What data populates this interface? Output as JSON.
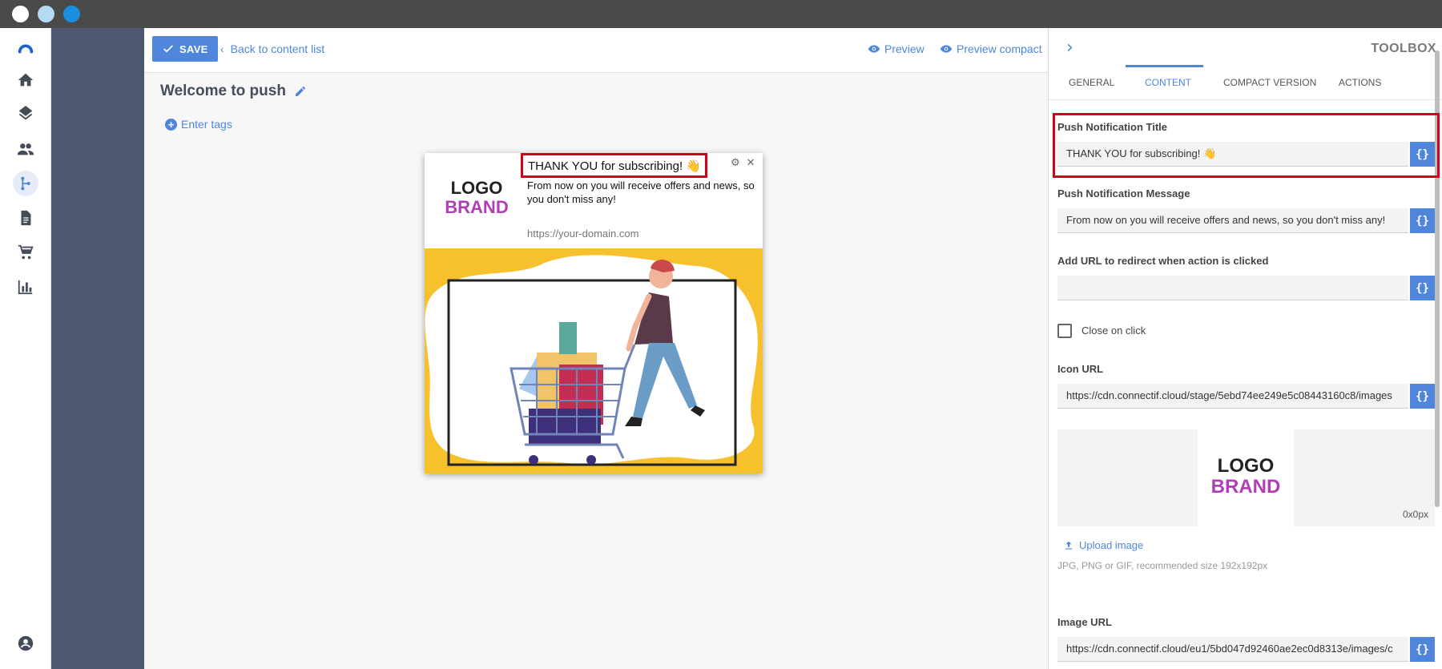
{
  "toolbar": {
    "save_label": "SAVE",
    "back_label": "Back to content list",
    "preview_label": "Preview",
    "preview_compact_label": "Preview compact"
  },
  "editor": {
    "title": "Welcome to push",
    "tags_label": "Enter tags"
  },
  "notification": {
    "logo_line1": "LOGO",
    "logo_line2": "BRAND",
    "title": "THANK YOU for subscribing! 👋",
    "message": "From now on you will receive offers and news, so you don't miss any!",
    "url": "https://your-domain.com"
  },
  "toolbox": {
    "title": "TOOLBOX",
    "tabs": [
      {
        "label": "GENERAL"
      },
      {
        "label": "CONTENT"
      },
      {
        "label": "COMPACT VERSION"
      },
      {
        "label": "ACTIONS"
      }
    ],
    "active_tab": "CONTENT",
    "push_title_label": "Push Notification Title",
    "push_title_value": "THANK YOU for subscribing! 👋",
    "push_message_label": "Push Notification Message",
    "push_message_value": "From now on you will receive offers and news, so you don't miss any!",
    "redirect_label": "Add URL to redirect when action is clicked",
    "redirect_value": "",
    "close_on_click_label": "Close on click",
    "close_on_click_checked": false,
    "icon_url_label": "Icon URL",
    "icon_url_value": "https://cdn.connectif.cloud/stage/5ebd74ee249e5c08443160c8/images",
    "preview_logo_line1": "LOGO",
    "preview_logo_line2": "BRAND",
    "preview_size": "0x0px",
    "upload_label": "Upload image",
    "upload_hint": "JPG, PNG or GIF, recommended size 192x192px",
    "image_url_label": "Image URL",
    "image_url_value": "https://cdn.connectif.cloud/eu1/5bd047d92460ae2ec0d8313e/images/c",
    "var_button_label": "{}"
  },
  "colors": {
    "accent": "#4f86dc",
    "highlight": "#d0021b",
    "brand_magenta": "#b03fb5",
    "sidebar_band": "#4c5770"
  }
}
